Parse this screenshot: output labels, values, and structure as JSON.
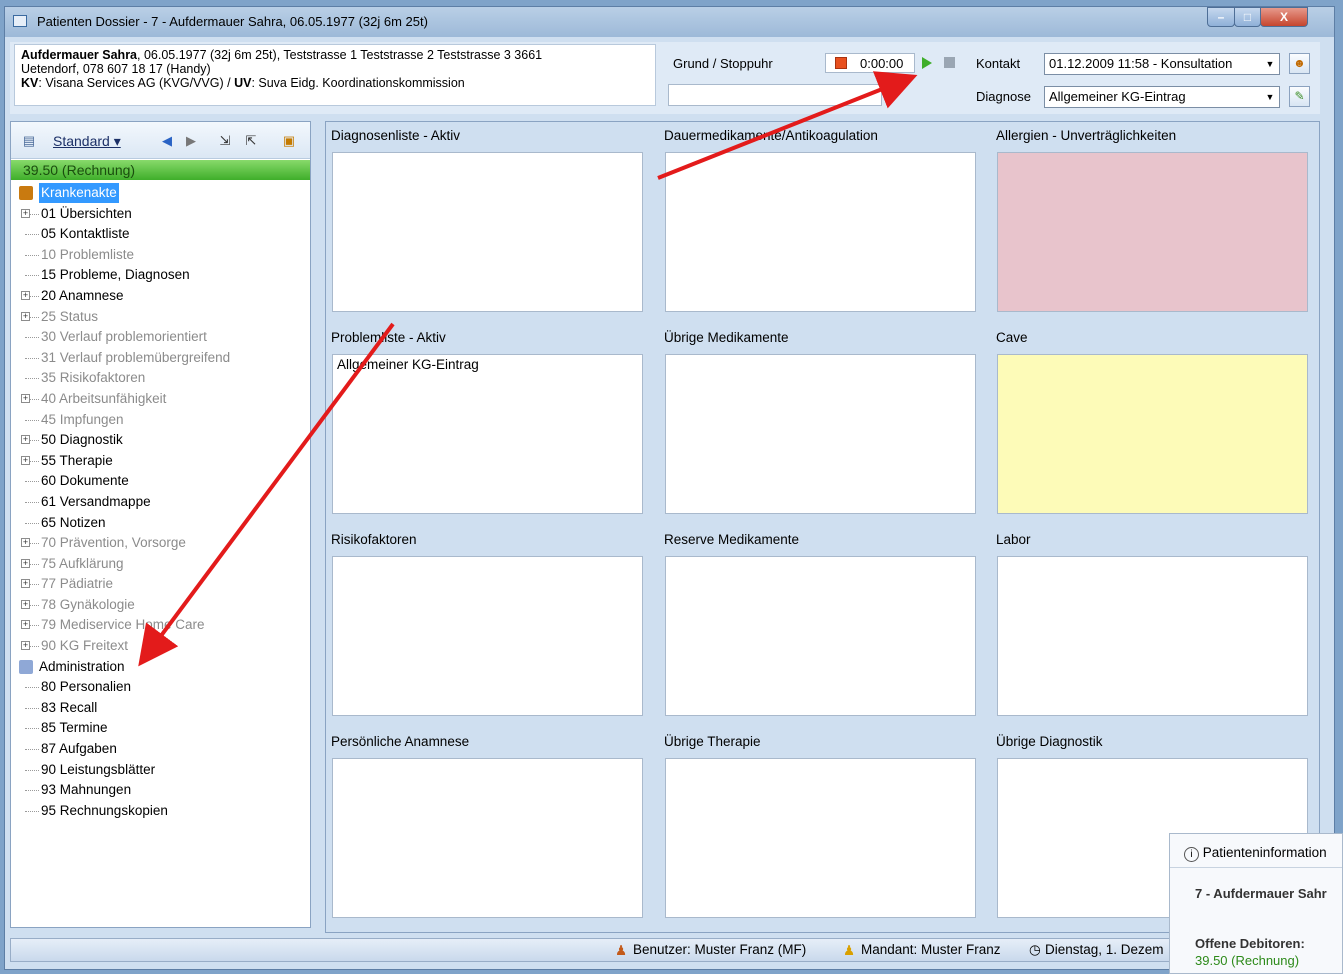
{
  "window": {
    "title": "Patienten Dossier - 7 - Aufdermauer Sahra, 06.05.1977 (32j 6m 25t)",
    "min": "–",
    "max": "□",
    "close": "X"
  },
  "patient": {
    "name": "Aufdermauer Sahra",
    "line1_rest": ", 06.05.1977 (32j 6m 25t), Teststrasse 1 Teststrasse 2 Teststrasse 3 3661",
    "line2": "Uetendorf, 078 607 18 17 (Handy)",
    "kv_label": "KV",
    "kv_value": ": Visana Services AG (KVG/VVG) / ",
    "uv_label": "UV",
    "uv_value": ": Suva Eidg. Koordinationskommission"
  },
  "header": {
    "grund_label": "Grund / Stoppuhr",
    "stopwatch": "0:00:00",
    "kontakt_label": "Kontakt",
    "kontakt_value": "01.12.2009 11:58 - Konsultation",
    "diagnose_label": "Diagnose",
    "diagnose_value": "Allgemeiner KG-Eintrag"
  },
  "sidebar": {
    "view_label": "Standard ▾",
    "balance": "39.50 (Rechnung)",
    "root1": "Krankenakte",
    "items1": [
      {
        "label": "01 Übersichten",
        "exp": true,
        "dim": false
      },
      {
        "label": "05 Kontaktliste",
        "exp": false,
        "dim": false
      },
      {
        "label": "10 Problemliste",
        "exp": false,
        "dim": true
      },
      {
        "label": "15 Probleme, Diagnosen",
        "exp": false,
        "dim": false
      },
      {
        "label": "20 Anamnese",
        "exp": true,
        "dim": false
      },
      {
        "label": "25 Status",
        "exp": true,
        "dim": true
      },
      {
        "label": "30 Verlauf problemorientiert",
        "exp": false,
        "dim": true
      },
      {
        "label": "31 Verlauf problemübergreifend",
        "exp": false,
        "dim": true
      },
      {
        "label": "35 Risikofaktoren",
        "exp": false,
        "dim": true
      },
      {
        "label": "40 Arbeitsunfähigkeit",
        "exp": true,
        "dim": true
      },
      {
        "label": "45 Impfungen",
        "exp": false,
        "dim": true
      },
      {
        "label": "50 Diagnostik",
        "exp": true,
        "dim": false
      },
      {
        "label": "55 Therapie",
        "exp": true,
        "dim": false
      },
      {
        "label": "60 Dokumente",
        "exp": false,
        "dim": false
      },
      {
        "label": "61 Versandmappe",
        "exp": false,
        "dim": false
      },
      {
        "label": "65 Notizen",
        "exp": false,
        "dim": false
      },
      {
        "label": "70 Prävention, Vorsorge",
        "exp": true,
        "dim": true
      },
      {
        "label": "75 Aufklärung",
        "exp": true,
        "dim": true
      },
      {
        "label": "77 Pädiatrie",
        "exp": true,
        "dim": true
      },
      {
        "label": "78 Gynäkologie",
        "exp": true,
        "dim": true
      },
      {
        "label": "79 Mediservice Home Care",
        "exp": true,
        "dim": true
      },
      {
        "label": "90 KG Freitext",
        "exp": true,
        "dim": true
      }
    ],
    "root2": "Administration",
    "items2": [
      {
        "label": "80 Personalien"
      },
      {
        "label": "83 Recall"
      },
      {
        "label": "85 Termine"
      },
      {
        "label": "87 Aufgaben"
      },
      {
        "label": "90 Leistungsblätter"
      },
      {
        "label": "93 Mahnungen"
      },
      {
        "label": "95 Rechnungskopien"
      }
    ]
  },
  "cells": [
    {
      "title": "Diagnosenliste - Aktiv",
      "content": "",
      "color": "#ffffff"
    },
    {
      "title": "Dauermedikamente/Antikoagulation",
      "content": "",
      "color": "#ffffff"
    },
    {
      "title": "Allergien - Unverträglichkeiten",
      "content": "",
      "color": "#e8c4cc"
    },
    {
      "title": "Problemliste - Aktiv",
      "content": "Allgemeiner KG-Eintrag",
      "color": "#ffffff"
    },
    {
      "title": "Übrige Medikamente",
      "content": "",
      "color": "#ffffff"
    },
    {
      "title": "Cave",
      "content": "",
      "color": "#fdfbb8"
    },
    {
      "title": "Risikofaktoren",
      "content": "",
      "color": "#ffffff"
    },
    {
      "title": "Reserve Medikamente",
      "content": "",
      "color": "#ffffff"
    },
    {
      "title": "Labor",
      "content": "",
      "color": "#ffffff"
    },
    {
      "title": "Persönliche Anamnese",
      "content": "",
      "color": "#ffffff"
    },
    {
      "title": "Übrige Therapie",
      "content": "",
      "color": "#ffffff"
    },
    {
      "title": "Übrige Diagnostik",
      "content": "",
      "color": "#ffffff"
    }
  ],
  "status": {
    "user": "Benutzer: Muster Franz  (MF)",
    "mandant": "Mandant: Muster Franz",
    "date": "Dienstag, 1. Dezem"
  },
  "popup": {
    "title": "Patienteninformation",
    "patient": "7 - Aufdermauer Sahr",
    "debitor_label": "Offene Debitoren:",
    "debitor_value": "39.50 (Rechnung)"
  },
  "colors": {
    "arrow": "#e31b1b",
    "selection": "#3399ff",
    "green": "#3fae2a"
  }
}
